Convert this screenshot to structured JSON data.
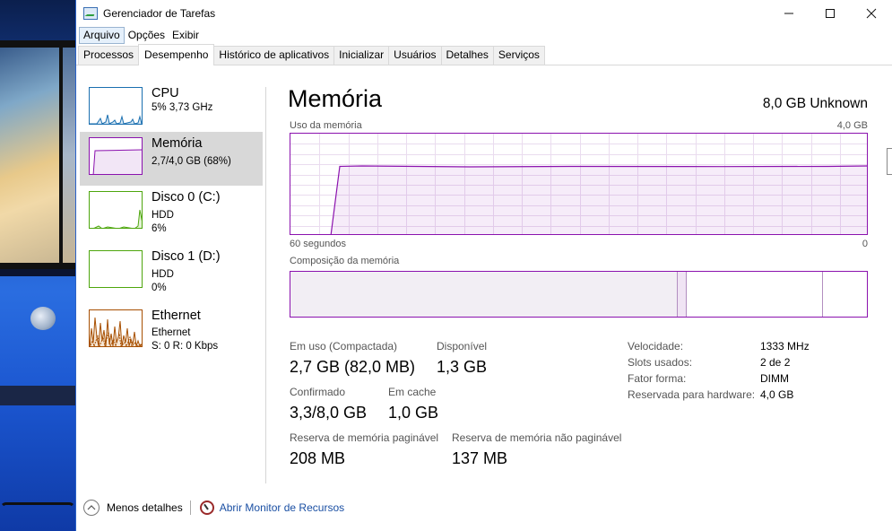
{
  "window": {
    "title": "Gerenciador de Tarefas"
  },
  "menu": [
    "Arquivo",
    "Opções",
    "Exibir"
  ],
  "tabs": [
    "Processos",
    "Desempenho",
    "Histórico de aplicativos",
    "Inicializar",
    "Usuários",
    "Detalhes",
    "Serviços"
  ],
  "active_tab": "Desempenho",
  "sidebar": {
    "items": [
      {
        "name": "CPU",
        "sub1": "5%  3,73 GHz",
        "color": "#1a6fb0"
      },
      {
        "name": "Memória",
        "sub1": "2,7/4,0 GB (68%)",
        "color": "#8b12ae",
        "selected": true
      },
      {
        "name": "Disco 0 (C:)",
        "sub1": "HDD",
        "sub2": "6%",
        "color": "#4da60c"
      },
      {
        "name": "Disco 1 (D:)",
        "sub1": "HDD",
        "sub2": "0%",
        "color": "#4da60c"
      },
      {
        "name": "Ethernet",
        "sub1": "Ethernet",
        "sub2": "S: 0  R: 0 Kbps",
        "color": "#a74f01"
      }
    ]
  },
  "main": {
    "title": "Memória",
    "total": "8,0 GB Unknown",
    "usage_label": "Uso da memória",
    "usage_max": "4,0 GB",
    "time_left": "60 segundos",
    "time_right": "0",
    "composition_label": "Composição da memória",
    "usage_level": 0.68,
    "stats": {
      "in_use_label": "Em uso (Compactada)",
      "in_use_value": "2,7 GB (82,0 MB)",
      "available_label": "Disponível",
      "available_value": "1,3 GB",
      "committed_label": "Confirmado",
      "committed_value": "3,3/8,0 GB",
      "cached_label": "Em cache",
      "cached_value": "1,0 GB",
      "paged_label": "Reserva de memória paginável",
      "paged_value": "208 MB",
      "nonpaged_label": "Reserva de memória não paginável",
      "nonpaged_value": "137 MB"
    },
    "specs": [
      {
        "label": "Velocidade:",
        "value": "1333 MHz"
      },
      {
        "label": "Slots usados:",
        "value": "2 de 2"
      },
      {
        "label": "Fator forma:",
        "value": "DIMM"
      },
      {
        "label": "Reservada para hardware:",
        "value": "4,0 GB"
      }
    ]
  },
  "footer": {
    "less_details": "Menos detalhes",
    "resource_monitor": "Abrir Monitor de Recursos"
  }
}
